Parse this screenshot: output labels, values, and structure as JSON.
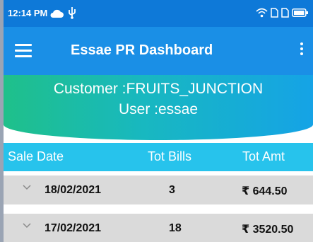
{
  "status_bar": {
    "time": "12:14 PM"
  },
  "app_bar": {
    "title": "Essae PR Dashboard"
  },
  "header": {
    "customer": "Customer :FRUITS_JUNCTION",
    "user": "User :essae"
  },
  "table": {
    "columns": [
      "Sale Date",
      "Tot Bills",
      "Tot Amt"
    ],
    "rows": [
      {
        "date": "18/02/2021",
        "bills": "3",
        "amount": "₹ 644.50"
      },
      {
        "date": "17/02/2021",
        "bills": "18",
        "amount": "₹ 3520.50"
      }
    ]
  },
  "colors": {
    "status_bar": "#0e79d8",
    "app_bar": "#1a8fe6",
    "header_gradient_start": "#1fc08a",
    "header_gradient_end": "#15a3e6",
    "table_header": "#27c3ec",
    "row_background": "#dadada"
  },
  "icons": [
    "cloud-icon",
    "usb-icon",
    "wifi-icon",
    "sim-icon",
    "battery-icon",
    "menu-icon",
    "more-vert-icon",
    "chevron-down-icon"
  ]
}
